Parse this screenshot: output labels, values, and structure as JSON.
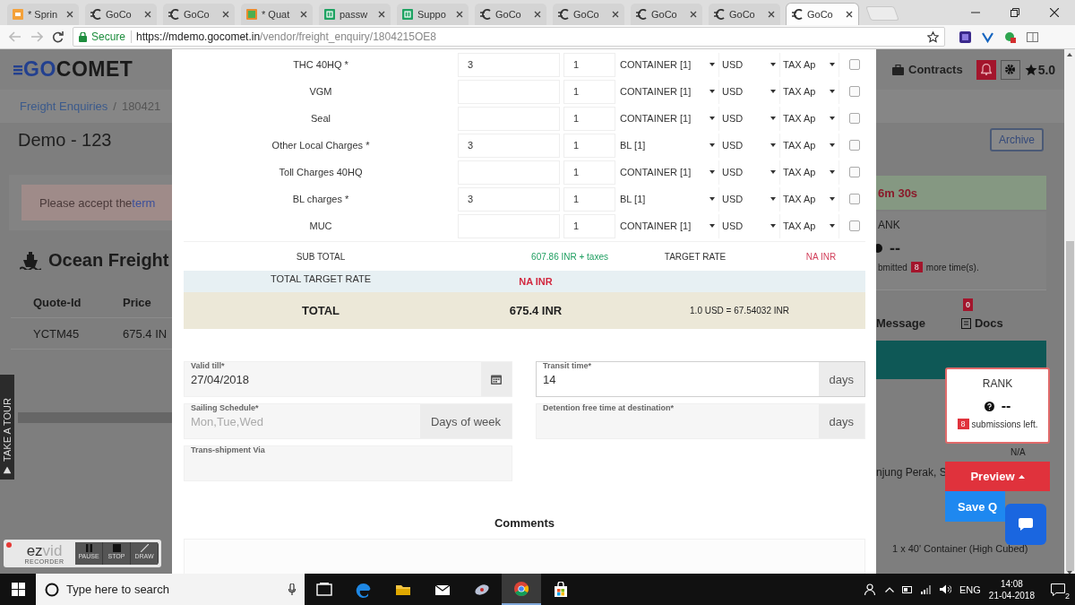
{
  "browser": {
    "tabs": [
      {
        "kind": "slides",
        "title": "* Sprin",
        "selected": false
      },
      {
        "kind": "site",
        "title": "GoCo",
        "selected": false
      },
      {
        "kind": "site",
        "title": "GoCo",
        "selected": false
      },
      {
        "kind": "form",
        "title": "* Quat",
        "selected": false
      },
      {
        "kind": "sheet",
        "title": "passw",
        "selected": false
      },
      {
        "kind": "sheet",
        "title": "Suppo",
        "selected": false
      },
      {
        "kind": "site",
        "title": "GoCo",
        "selected": false
      },
      {
        "kind": "site",
        "title": "GoCo",
        "selected": false
      },
      {
        "kind": "site",
        "title": "GoCo",
        "selected": false
      },
      {
        "kind": "site",
        "title": "GoCo",
        "selected": false
      },
      {
        "kind": "site",
        "title": "GoCo",
        "selected": true
      }
    ],
    "address": {
      "security": "Secure",
      "host": "https://mdemo.gocomet.in",
      "path": "/vendor/freight_enquiry/1804215OE8"
    }
  },
  "page": {
    "logo": {
      "accent": "GO",
      "rest": "COMET"
    },
    "breadcrumb": {
      "link": "Freight Enquiries",
      "separator": "/",
      "current": "180421"
    },
    "title": "Demo - 123",
    "alert": {
      "text": "Please accept the ",
      "link": "term"
    },
    "section_title": "Ocean Freight",
    "quotes": {
      "columns": [
        "Quote-Id",
        "Price"
      ],
      "rows": [
        [
          "YCTM45",
          "675.4 IN"
        ]
      ]
    },
    "tour": "TAKE A TOUR",
    "nav": {
      "contracts": "Contracts",
      "rating": "5.0"
    },
    "archive": "Archive",
    "timer": "6m 30s",
    "rank_panel": {
      "title": "ANK",
      "value": "--",
      "note_before": "bmitted",
      "count": "8",
      "note_after": "more time(s)."
    },
    "tabs": [
      {
        "label": "Message"
      },
      {
        "label": "Docs",
        "badge": "0"
      }
    ],
    "details": [
      "N/A",
      "njung Perak, S",
      "1 x 40' Container (High Cubed)"
    ]
  },
  "modal": {
    "charges": [
      {
        "name": "THC 40HQ *",
        "rate": "3",
        "quantity": "1",
        "unit": "CONTAINER [1]",
        "currency": "USD",
        "tax": "TAX Ap",
        "checked": false
      },
      {
        "name": "VGM",
        "quantity": "1",
        "unit": "CONTAINER [1]",
        "currency": "USD",
        "tax": "TAX Ap",
        "checked": false
      },
      {
        "name": "Seal",
        "quantity": "1",
        "unit": "CONTAINER [1]",
        "currency": "USD",
        "tax": "TAX Ap",
        "checked": false
      },
      {
        "name": "Other Local Charges *",
        "rate": "3",
        "quantity": "1",
        "unit": "BL [1]",
        "currency": "USD",
        "tax": "TAX Ap",
        "checked": false
      },
      {
        "name": "Toll Charges 40HQ",
        "quantity": "1",
        "unit": "CONTAINER [1]",
        "currency": "USD",
        "tax": "TAX Ap",
        "checked": false
      },
      {
        "name": "BL charges *",
        "rate": "3",
        "quantity": "1",
        "unit": "BL [1]",
        "currency": "USD",
        "tax": "TAX Ap",
        "checked": false
      },
      {
        "name": "MUC",
        "quantity": "1",
        "unit": "CONTAINER [1]",
        "currency": "USD",
        "tax": "TAX Ap",
        "checked": false
      }
    ],
    "subtotal": {
      "label": "SUB TOTAL",
      "value": "607.86 INR + taxes",
      "target_label": "TARGET RATE",
      "target_value": "NA INR"
    },
    "total_target": {
      "label": "TOTAL TARGET RATE",
      "value": "NA INR"
    },
    "total": {
      "label": "TOTAL",
      "value": "675.4 INR",
      "rate": "1.0 USD = 67.54032 INR"
    },
    "fields": [
      {
        "kind": "date",
        "label": "Valid till*",
        "value": "27/04/2018",
        "focused": false
      },
      {
        "kind": "addon",
        "label": "Transit time*",
        "value": "14",
        "addon": "days",
        "focused": true
      },
      {
        "kind": "addon",
        "label": "Sailing Schedule*",
        "placeholder": "Mon,Tue,Wed",
        "addon": "Days of week",
        "focused": false
      },
      {
        "kind": "addon",
        "label": "Detention free time at destination*",
        "addon": "days",
        "focused": false
      },
      {
        "kind": "plain",
        "label": "Trans-shipment Via",
        "focused": false
      }
    ],
    "comments": {
      "title": "Comments"
    }
  },
  "floating": {
    "rank": {
      "title": "RANK",
      "value": "--",
      "count": "8",
      "note": "submissions left."
    },
    "preview": "Preview",
    "save": "Save Q"
  },
  "recorder": {
    "brand_dark": "ez",
    "brand_light": "vid",
    "sub": "RECORDER",
    "buttons": [
      "PAUSE",
      "STOP",
      "DRAW"
    ]
  },
  "taskbar": {
    "search": {
      "placeholder": "Type here to search"
    },
    "apps": [
      {
        "kind": "taskview",
        "selected": false
      },
      {
        "kind": "edge",
        "selected": false
      },
      {
        "kind": "folder",
        "selected": false
      },
      {
        "kind": "mail",
        "selected": false
      },
      {
        "kind": "disc",
        "selected": false
      },
      {
        "kind": "chrome",
        "selected": true
      },
      {
        "kind": "store",
        "selected": false
      }
    ],
    "language": "ENG",
    "time": "14:08",
    "date": "21-04-2018",
    "notifications": "2"
  }
}
